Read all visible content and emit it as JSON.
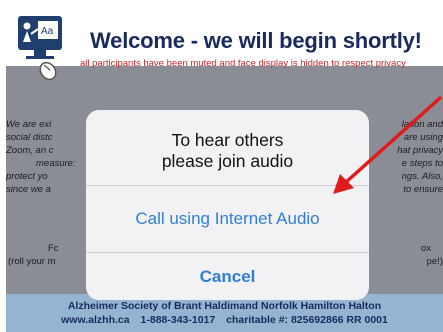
{
  "slide": {
    "title": "Welcome - we will begin shortly!",
    "subtitle": "all participants have been muted and face display is hidden to respect privacy",
    "body_left": [
      "We are exi",
      "social distc",
      "Zoom, an c",
      "measure:",
      "protect yo",
      "since we a"
    ],
    "body_right": [
      "lation and",
      "are using",
      "hat privacy",
      "e steps to",
      "ngs. Also,",
      "to ensure"
    ],
    "bottom_left": [
      "Fc",
      "(roll your m"
    ],
    "bottom_right": [
      "ox",
      "pe!)"
    ],
    "footer_line1": "Alzheimer Society of Brant Haldimand Norfolk Hamilton Halton",
    "footer_web": "www.alzhh.ca",
    "footer_phone": "1-888-343-1017",
    "footer_charity": "charitable #: 825692866 RR 0001"
  },
  "dialog": {
    "title_line1": "To hear others",
    "title_line2": "please join audio",
    "call_label": "Call using Internet Audio",
    "cancel_label": "Cancel"
  },
  "colors": {
    "title": "#1a2a5e",
    "subtitle": "#c0282d",
    "button_blue": "#2f7fd6",
    "footer_bg": "#95b4d2",
    "arrow": "#e01b1b"
  },
  "icons": {
    "logo": "computer-presentation-icon"
  }
}
